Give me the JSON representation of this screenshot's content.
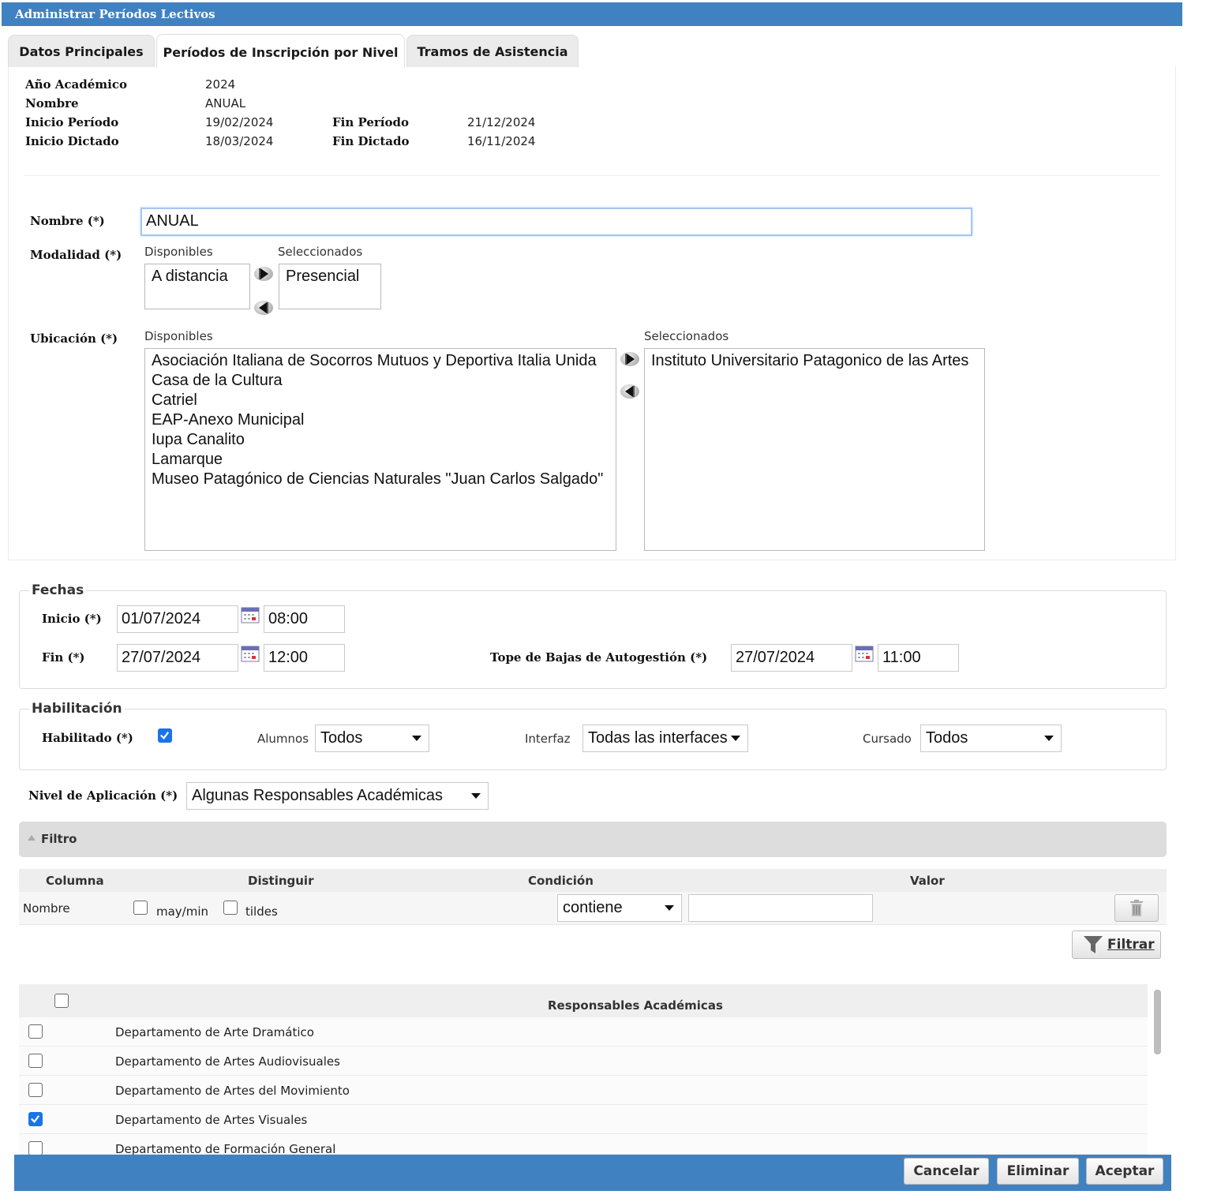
{
  "window": {
    "title": "Administrar Períodos Lectivos"
  },
  "tabs": [
    {
      "label": "Datos Principales"
    },
    {
      "label": "Períodos de Inscripción por Nivel"
    },
    {
      "label": "Tramos de Asistencia"
    }
  ],
  "info": {
    "anio_label": "Año Académico",
    "anio_value": "2024",
    "nombre_label": "Nombre",
    "nombre_value": "ANUAL",
    "inicio_periodo_label": "Inicio Período",
    "inicio_periodo_value": "19/02/2024",
    "fin_periodo_label": "Fin Período",
    "fin_periodo_value": "21/12/2024",
    "inicio_dictado_label": "Inicio Dictado",
    "inicio_dictado_value": "18/03/2024",
    "fin_dictado_label": "Fin Dictado",
    "fin_dictado_value": "16/11/2024"
  },
  "form": {
    "nombre_label": "Nombre (*)",
    "nombre_value": "ANUAL",
    "modalidad_label": "Modalidad (*)",
    "modalidad_disponibles_label": "Disponibles",
    "modalidad_seleccionados_label": "Seleccionados",
    "modalidad_disponibles": [
      "A distancia"
    ],
    "modalidad_seleccionados": [
      "Presencial"
    ],
    "ubicacion_label": "Ubicación (*)",
    "ubicacion_disponibles_label": "Disponibles",
    "ubicacion_seleccionados_label": "Seleccionados",
    "ubicacion_disponibles": [
      "Asociación Italiana de Socorros Mutuos y Deportiva Italia Unida",
      "Casa de la Cultura",
      "Catriel",
      "EAP-Anexo Municipal",
      "Iupa Canalito",
      "Lamarque",
      "Museo Patagónico de Ciencias Naturales \"Juan Carlos Salgado\""
    ],
    "ubicacion_seleccionados": [
      "Instituto Universitario Patagonico de las Artes"
    ]
  },
  "fechas": {
    "legend": "Fechas",
    "inicio_label": "Inicio (*)",
    "inicio_date": "01/07/2024",
    "inicio_time": "08:00",
    "fin_label": "Fin (*)",
    "fin_date": "27/07/2024",
    "fin_time": "12:00",
    "tope_label": "Tope de Bajas de Autogestión (*)",
    "tope_date": "27/07/2024",
    "tope_time": "11:00"
  },
  "habilitacion": {
    "legend": "Habilitación",
    "habilitado_label": "Habilitado (*)",
    "habilitado_checked": true,
    "alumnos_label": "Alumnos",
    "alumnos_value": "Todos",
    "interfaz_label": "Interfaz",
    "interfaz_value": "Todas las interfaces",
    "cursado_label": "Cursado",
    "cursado_value": "Todos"
  },
  "nivel": {
    "label": "Nivel de Aplicación (*)",
    "value": "Algunas Responsables Académicas"
  },
  "filtro": {
    "title": "Filtro",
    "col_columna": "Columna",
    "col_distinguir": "Distinguir",
    "col_condicion": "Condición",
    "col_valor": "Valor",
    "row_nombre": "Nombre",
    "maymin_label": "may/min",
    "tildes_label": "tildes",
    "condicion_value": "contiene",
    "valor_value": "",
    "filtrar_button": "Filtrar"
  },
  "tabla": {
    "header": "Responsables Académicas",
    "rows": [
      {
        "label": "Departamento de Arte Dramático",
        "checked": false
      },
      {
        "label": "Departamento de Artes Audiovisuales",
        "checked": false
      },
      {
        "label": "Departamento de Artes del Movimiento",
        "checked": false
      },
      {
        "label": "Departamento de Artes Visuales",
        "checked": true
      },
      {
        "label": "Departamento de Formación General",
        "checked": false
      }
    ]
  },
  "footer": {
    "cancelar": "Cancelar",
    "eliminar": "Eliminar",
    "aceptar": "Aceptar"
  },
  "colors": {
    "accent": "#4081c2",
    "checkbox": "#1a73e8",
    "filter_bar": "#dddddd"
  },
  "icons": [
    "calendar-icon",
    "arrow-right-icon",
    "arrow-left-icon",
    "trash-icon",
    "funnel-icon",
    "collapse-caret-icon",
    "checkmark-icon"
  ]
}
